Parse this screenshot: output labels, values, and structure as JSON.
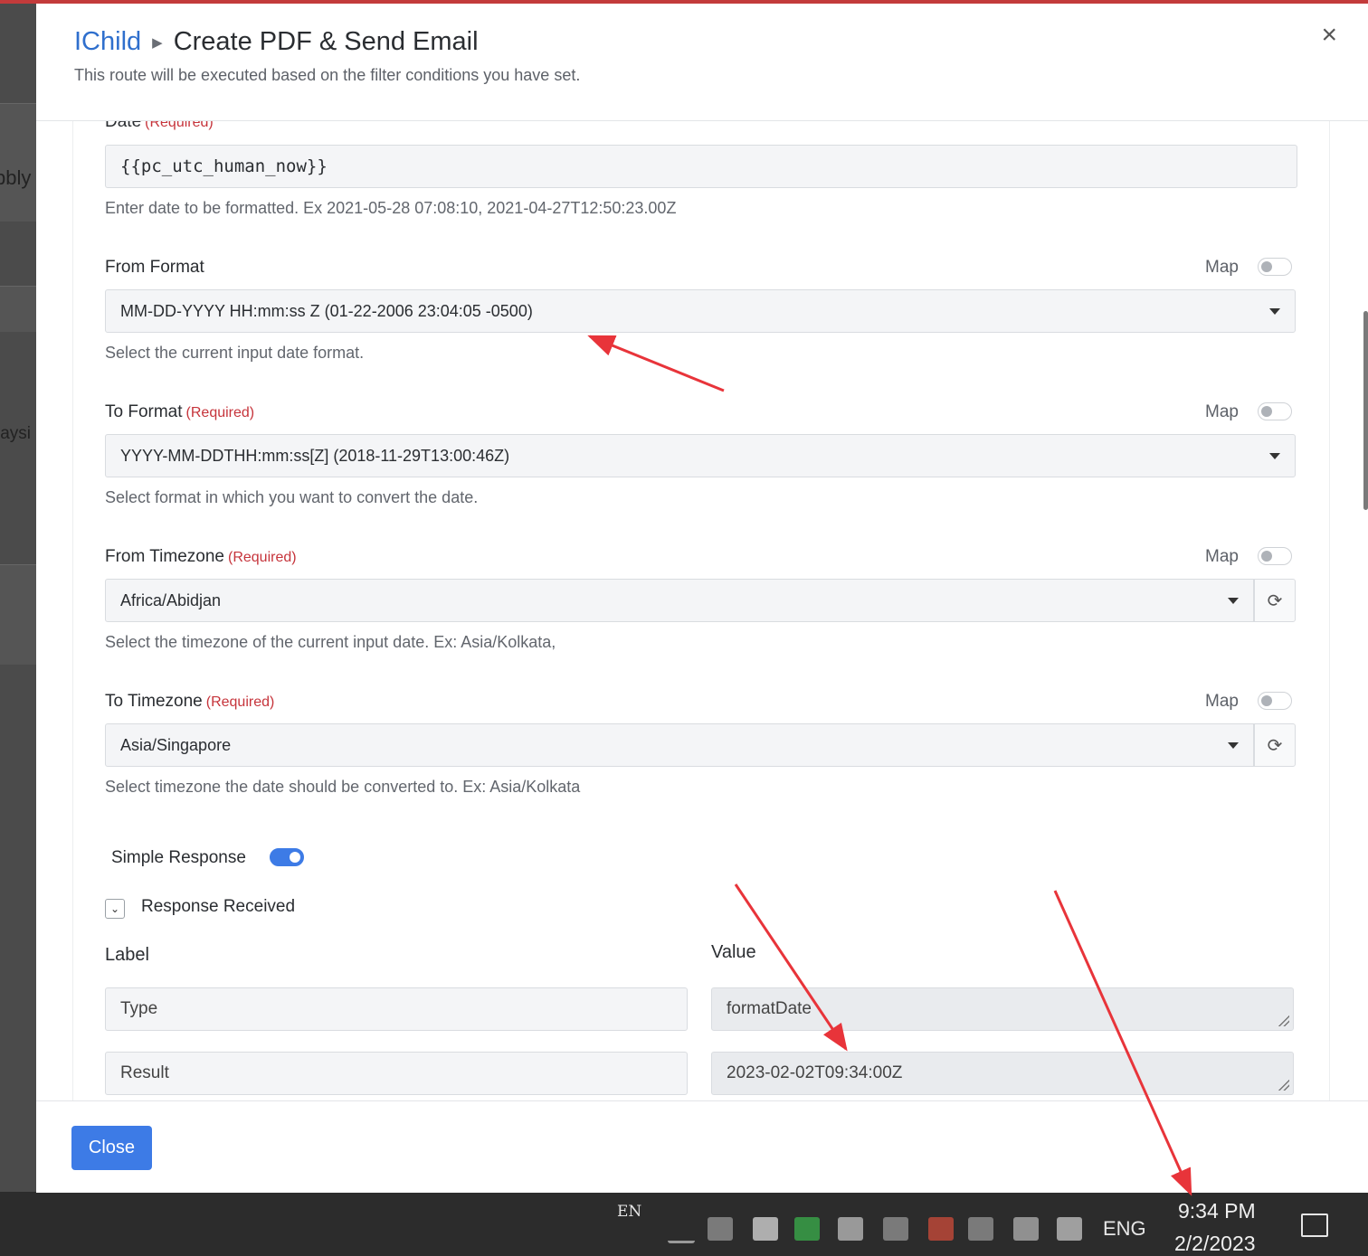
{
  "header": {
    "app_name": "IChild",
    "title": "Create PDF & Send Email",
    "subtitle": "This route will be executed based on the filter conditions you have set.",
    "close_symbol": "×"
  },
  "background": {
    "text1": "bbly",
    "text2": "laysi"
  },
  "form": {
    "date": {
      "label": "Date",
      "required": "(Required)",
      "value": "{{pc_utc_human_now}}",
      "hint": "Enter date to be formatted. Ex 2021-05-28 07:08:10, 2021-04-27T12:50:23.00Z"
    },
    "from_format": {
      "label": "From Format",
      "map_label": "Map",
      "map_on": false,
      "value": "MM-DD-YYYY HH:mm:ss Z (01-22-2006 23:04:05 -0500)",
      "hint": "Select the current input date format."
    },
    "to_format": {
      "label": "To Format",
      "required": "(Required)",
      "map_label": "Map",
      "map_on": false,
      "value": "YYYY-MM-DDTHH:mm:ss[Z] (2018-11-29T13:00:46Z)",
      "hint": "Select format in which you want to convert the date."
    },
    "from_timezone": {
      "label": "From Timezone",
      "required": "(Required)",
      "map_label": "Map",
      "map_on": false,
      "value": "Africa/Abidjan",
      "hint": "Select the timezone of the current input date. Ex: Asia/Kolkata,"
    },
    "to_timezone": {
      "label": "To Timezone",
      "required": "(Required)",
      "map_label": "Map",
      "map_on": false,
      "value": "Asia/Singapore",
      "hint": "Select timezone the date should be converted to. Ex: Asia/Kolkata"
    },
    "simple_response": {
      "label": "Simple Response",
      "on": true
    }
  },
  "response": {
    "title": "Response Received",
    "label_header": "Label",
    "value_header": "Value",
    "rows": [
      {
        "label": "Type",
        "value": "formatDate"
      },
      {
        "label": "Result",
        "value": "2023-02-02T09:34:00Z"
      }
    ]
  },
  "footer": {
    "close_label": "Close"
  },
  "taskbar": {
    "input_indicator": "EN",
    "language": "ENG",
    "time": "9:34 PM",
    "date": "2/2/2023"
  },
  "colors": {
    "accent": "#3d7be6",
    "required": "#c6343b",
    "annotation": "#e8343a"
  },
  "icons": [
    "close-icon",
    "dropdown-arrow-icon",
    "refresh-icon",
    "chevron-down-icon",
    "notification-icon"
  ]
}
